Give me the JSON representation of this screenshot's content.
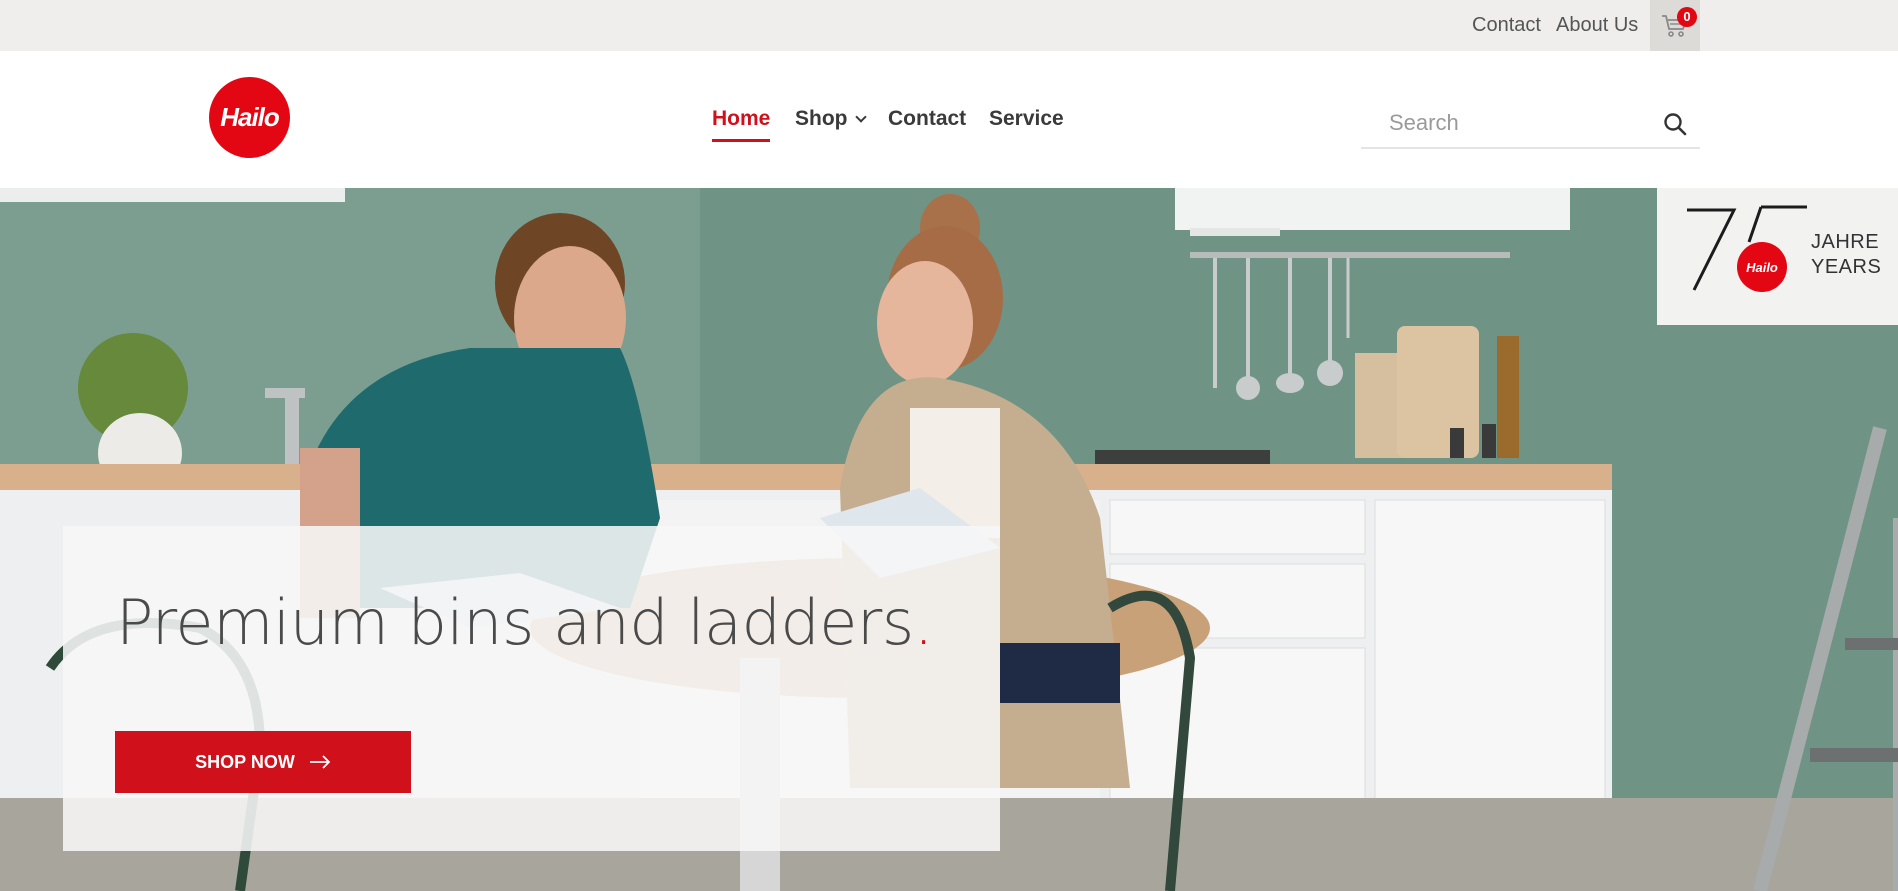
{
  "topbar": {
    "contact_label": "Contact",
    "about_label": "About Us",
    "cart_count": "0"
  },
  "header": {
    "logo_text": "Hailo",
    "nav": {
      "home": "Home",
      "shop": "Shop",
      "contact": "Contact",
      "service": "Service"
    },
    "search": {
      "placeholder": "Search",
      "value": ""
    }
  },
  "hero": {
    "title": "Premium bins and ladders",
    "title_dot": ".",
    "cta_label": "SHOP NOW"
  },
  "anniversary_badge": {
    "number": "75",
    "logo_text": "Hailo",
    "line1": "JAHRE",
    "line2": "YEARS"
  },
  "colors": {
    "brand_red": "#e30613",
    "active_nav": "#d0101b",
    "topbar_bg": "#efeeec",
    "hero_wall": "#6f9384"
  },
  "icons": {
    "cart": "cart-icon",
    "search": "search-icon",
    "chevron": "chevron-down-icon",
    "arrow": "arrow-right-icon"
  }
}
